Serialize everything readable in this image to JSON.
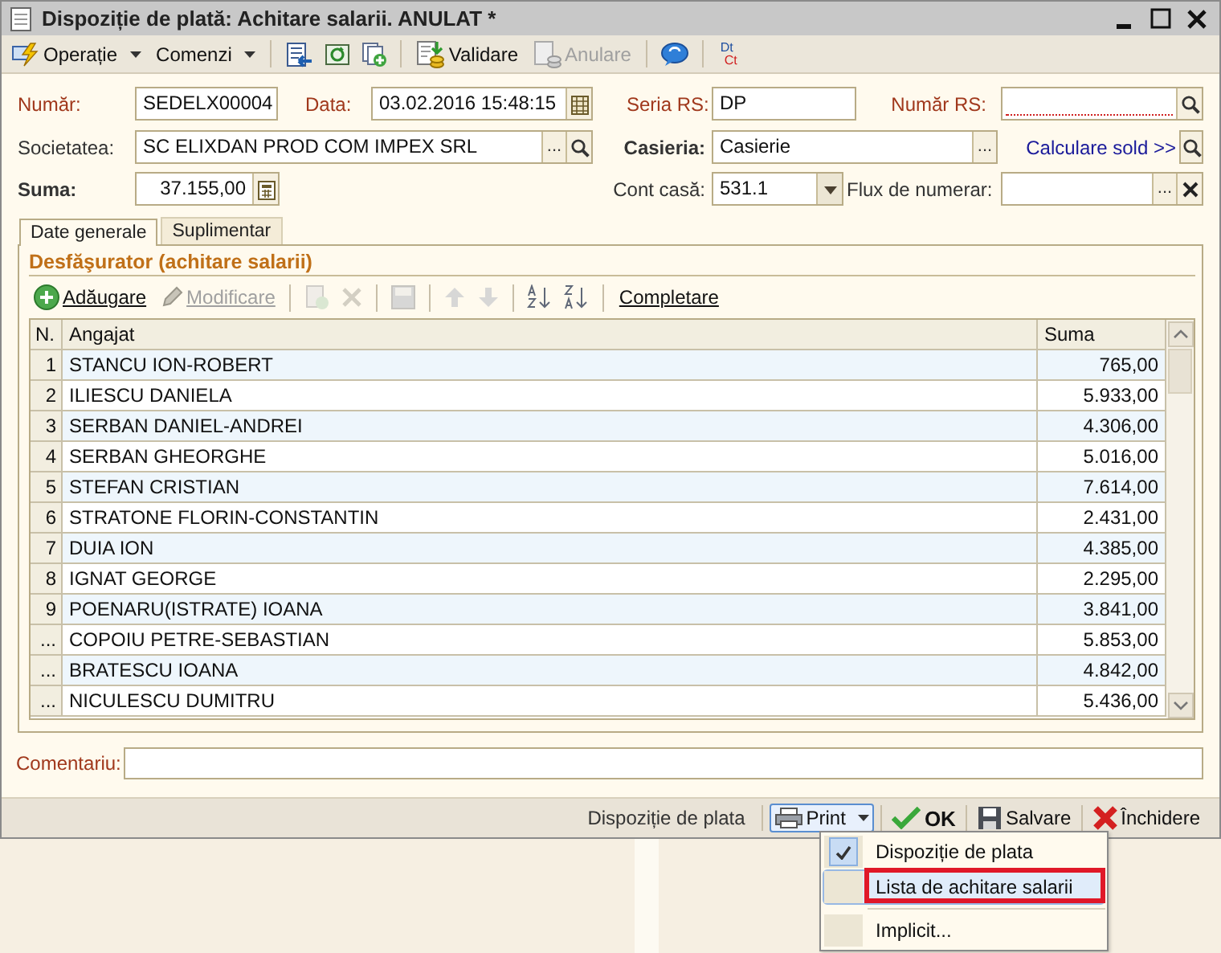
{
  "window": {
    "title": "Dispoziție de plată: Achitare salarii. ANULAT *"
  },
  "toolbar": [
    {
      "kind": "dropdown",
      "label": "Operație",
      "disabled": false
    },
    {
      "kind": "dropdown",
      "label": "Comenzi",
      "disabled": false
    },
    {
      "kind": "separator"
    },
    {
      "kind": "icon",
      "disabled": false
    },
    {
      "kind": "icon",
      "disabled": false
    },
    {
      "kind": "icon",
      "disabled": false
    },
    {
      "kind": "separator"
    },
    {
      "kind": "button",
      "label": "Validare",
      "disabled": false
    },
    {
      "kind": "button",
      "label": "Anulare",
      "disabled": true
    },
    {
      "kind": "separator"
    },
    {
      "kind": "icon",
      "disabled": false
    },
    {
      "kind": "separator"
    },
    {
      "kind": "dtct",
      "top": "Dt",
      "bottom": "Ct"
    }
  ],
  "form": {
    "rows": [
      {
        "items": [
          {
            "kind": "label",
            "text": "Număr:",
            "required": true,
            "emphasis": false
          },
          {
            "kind": "field",
            "value": "SEDELX00004",
            "invalid": false
          },
          {
            "kind": "label",
            "text": "Data:",
            "required": true,
            "emphasis": false
          },
          {
            "kind": "field",
            "value": "03.02.2016 15:48:15",
            "invalid": false,
            "addons": [
              {
                "kind": "calendar"
              }
            ]
          },
          {
            "kind": "label",
            "text": "Seria RS:",
            "required": true,
            "emphasis": false
          },
          {
            "kind": "field",
            "value": "DP",
            "invalid": false
          },
          {
            "kind": "label",
            "text": "Număr RS:",
            "required": true,
            "emphasis": false
          },
          {
            "kind": "field",
            "invalid": true,
            "addons": [
              {
                "kind": "search"
              }
            ]
          }
        ]
      },
      {
        "items": [
          {
            "kind": "label",
            "text": "Societatea:",
            "required": false,
            "emphasis": false
          },
          {
            "kind": "field",
            "value": "SC ELIXDAN PROD COM IMPEX SRL",
            "invalid": false,
            "addons": [
              {
                "kind": "text",
                "text": "..."
              },
              {
                "kind": "search"
              }
            ]
          },
          {
            "kind": "label",
            "text": "Casieria:",
            "required": false,
            "emphasis": true
          },
          {
            "kind": "field",
            "value": "Casierie",
            "invalid": false,
            "addons": [
              {
                "kind": "text",
                "text": "..."
              }
            ]
          },
          {
            "kind": "link",
            "text": "Calculare sold >>"
          },
          {
            "kind": "search"
          }
        ]
      },
      {
        "items": [
          {
            "kind": "label",
            "text": "Suma:",
            "required": false,
            "emphasis": true
          },
          {
            "kind": "amount",
            "value": "37.155,00",
            "invalid": false,
            "addons": [
              {
                "kind": "calculator"
              }
            ]
          },
          {
            "kind": "label",
            "text": "Cont casă:",
            "required": false,
            "emphasis": false
          },
          {
            "kind": "field",
            "value": "531.1",
            "invalid": false,
            "addons": [
              {
                "kind": "dropdown"
              }
            ]
          },
          {
            "kind": "label",
            "text": "Flux de numerar:",
            "required": false,
            "emphasis": false
          },
          {
            "kind": "field",
            "invalid": false,
            "addons": [
              {
                "kind": "text",
                "text": "..."
              },
              {
                "kind": "clear"
              }
            ]
          }
        ]
      }
    ]
  },
  "tabs": [
    {
      "label": "Date generale",
      "selected": true
    },
    {
      "label": "Suplimentar",
      "selected": false
    }
  ],
  "group": {
    "title": "Desfăşurator (achitare salarii)",
    "toolbar": [
      {
        "kind": "button",
        "label": "Adăugare",
        "disabled": false
      },
      {
        "kind": "button",
        "label": "Modificare",
        "disabled": true
      },
      {
        "kind": "separator"
      },
      {
        "kind": "icon",
        "disabled": true
      },
      {
        "kind": "icon",
        "disabled": true
      },
      {
        "kind": "separator"
      },
      {
        "kind": "icon",
        "disabled": true
      },
      {
        "kind": "separator"
      },
      {
        "kind": "icon",
        "disabled": true
      },
      {
        "kind": "icon",
        "disabled": true
      },
      {
        "kind": "separator"
      },
      {
        "kind": "icon",
        "disabled": false
      },
      {
        "kind": "icon",
        "disabled": false
      },
      {
        "kind": "separator"
      },
      {
        "kind": "button",
        "label": "Completare",
        "disabled": false
      }
    ],
    "table": {
      "columns": [
        "N.",
        "Angajat",
        "Suma"
      ],
      "rows": [
        {
          "n": "1",
          "name": "STANCU ION-ROBERT",
          "amount": "765,00"
        },
        {
          "n": "2",
          "name": "ILIESCU DANIELA",
          "amount": "5.933,00"
        },
        {
          "n": "3",
          "name": "SERBAN DANIEL-ANDREI",
          "amount": "4.306,00"
        },
        {
          "n": "4",
          "name": "SERBAN GHEORGHE",
          "amount": "5.016,00"
        },
        {
          "n": "5",
          "name": "STEFAN CRISTIAN",
          "amount": "7.614,00"
        },
        {
          "n": "6",
          "name": "STRATONE FLORIN-CONSTANTIN",
          "amount": "2.431,00"
        },
        {
          "n": "7",
          "name": "DUIA ION",
          "amount": "4.385,00"
        },
        {
          "n": "8",
          "name": "IGNAT GEORGE",
          "amount": "2.295,00"
        },
        {
          "n": "9",
          "name": "POENARU(ISTRATE) IOANA",
          "amount": "3.841,00"
        },
        {
          "n": "...",
          "name": "COPOIU PETRE-SEBASTIAN",
          "amount": "5.853,00"
        },
        {
          "n": "...",
          "name": "BRATESCU IOANA",
          "amount": "4.842,00"
        },
        {
          "n": "...",
          "name": "NICULESCU DUMITRU",
          "amount": "5.436,00"
        }
      ]
    }
  },
  "comment": {
    "label": "Comentariu:"
  },
  "status_bar": [
    {
      "kind": "text",
      "label": "Dispoziție de plata"
    },
    {
      "kind": "print",
      "label": "Print",
      "active": true
    },
    {
      "kind": "ok",
      "label": "OK"
    },
    {
      "kind": "save",
      "label": "Salvare"
    },
    {
      "kind": "close",
      "label": "Închidere"
    }
  ],
  "menu": [
    {
      "kind": "item",
      "label": "Dispoziție de plata",
      "checked": true,
      "selected": false,
      "outlined": false
    },
    {
      "kind": "item",
      "label": "Lista de achitare salarii",
      "checked": false,
      "selected": true,
      "outlined": true
    },
    {
      "kind": "separator"
    },
    {
      "kind": "item",
      "label": "Implicit...",
      "checked": false,
      "selected": false,
      "outlined": false
    }
  ]
}
